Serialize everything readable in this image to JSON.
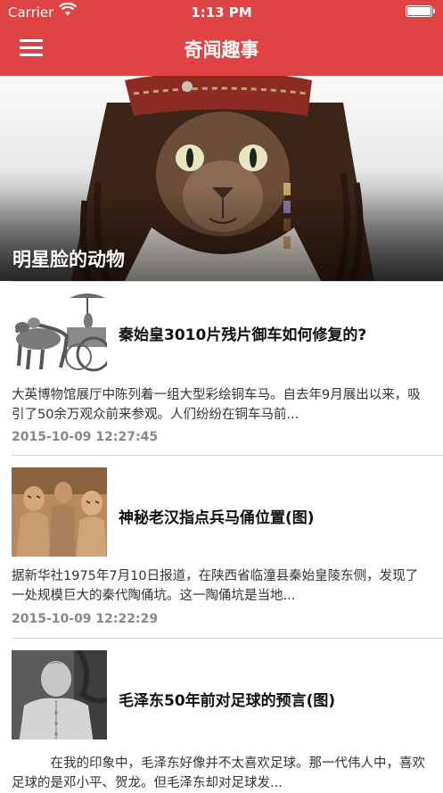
{
  "status_bar": {
    "carrier": "Carrier",
    "time": "1:13 PM"
  },
  "header": {
    "title": "奇闻趣事",
    "menu_icon": "hamburger-menu-icon"
  },
  "banner": {
    "caption": "明星脸的动物"
  },
  "articles": [
    {
      "title": "秦始皇3010片残片御车如何修复的?",
      "summary": "大英博物馆展厅中陈列着一组大型彩绘铜车马。自去年9月展出以来，吸引了50余万观众前来参观。人们纷纷在铜车马前...",
      "date": "2015-10-09 12:27:45"
    },
    {
      "title": "神秘老汉指点兵马俑位置(图)",
      "summary": "据新华社1975年7月10日报道，在陕西省临潼县秦始皇陵东侧，发现了一处规模巨大的秦代陶俑坑。这一陶俑坑是当地...",
      "date": "2015-10-09 12:22:29"
    },
    {
      "title": "毛泽东50年前对足球的预言(图)",
      "summary": "　　　在我的印象中，毛泽东好像并不太喜欢足球。那一代伟人中，喜欢足球的是邓小平、贺龙。但毛泽东却对足球发...",
      "date": ""
    }
  ],
  "colors": {
    "header": "#e04343",
    "date": "#888888"
  }
}
